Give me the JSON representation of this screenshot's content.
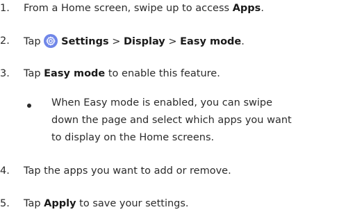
{
  "steps": [
    {
      "num": "1.",
      "pre": "From a Home screen, swipe up to access ",
      "b1": "Apps",
      "post": "."
    },
    {
      "num": "2.",
      "pre": "Tap ",
      "b1": "Settings",
      "sep1": " > ",
      "b2": "Display",
      "sep2": " > ",
      "b3": "Easy mode",
      "post": "."
    },
    {
      "num": "3.",
      "pre": "Tap ",
      "b1": "Easy mode",
      "post": " to enable this feature."
    },
    {
      "num": "4.",
      "text": "Tap the apps you want to add or remove."
    },
    {
      "num": "5.",
      "pre": "Tap ",
      "b1": "Apply",
      "post": " to save your settings."
    }
  ],
  "bullet": {
    "line1": "When Easy mode is enabled, you can swipe",
    "line2": "down the page and select which apps you want",
    "line3": "to display on the Home screens."
  },
  "icons": {
    "settings": "settings-gear-icon",
    "bullet": "bullet-icon"
  },
  "colors": {
    "text": "#2b2b2b",
    "settings_icon": "#6f86e8"
  }
}
